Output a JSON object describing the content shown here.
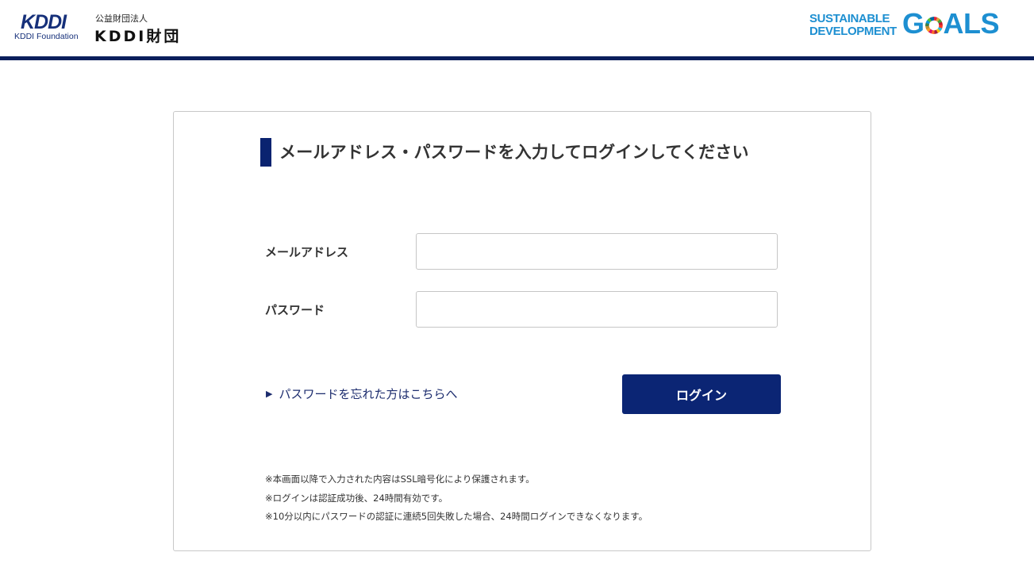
{
  "header": {
    "logo_mark": "KDDI",
    "logo_sub": "KDDI Foundation",
    "org_type": "公益財団法人",
    "org_name": "KDDI財団",
    "sdg_line1": "SUSTAINABLE",
    "sdg_line2": "DEVELOPMENT",
    "sdg_goals_g": "G",
    "sdg_goals_rest": "ALS",
    "header_bar_color": "#0a1f5c"
  },
  "form": {
    "title": "メールアドレス・パスワードを入力してログインしてください",
    "email_label": "メールアドレス",
    "email_value": "",
    "password_label": "パスワード",
    "password_value": "",
    "forgot_link": "パスワードを忘れた方はこちらへ",
    "login_button": "ログイン",
    "accent_color": "#0b2574"
  },
  "notes": [
    "※本画面以降で入力された内容はSSL暗号化により保護されます。",
    "※ログインは認証成功後、24時間有効です。",
    "※10分以内にパスワードの認証に連続5回失敗した場合、24時間ログインできなくなります。"
  ]
}
